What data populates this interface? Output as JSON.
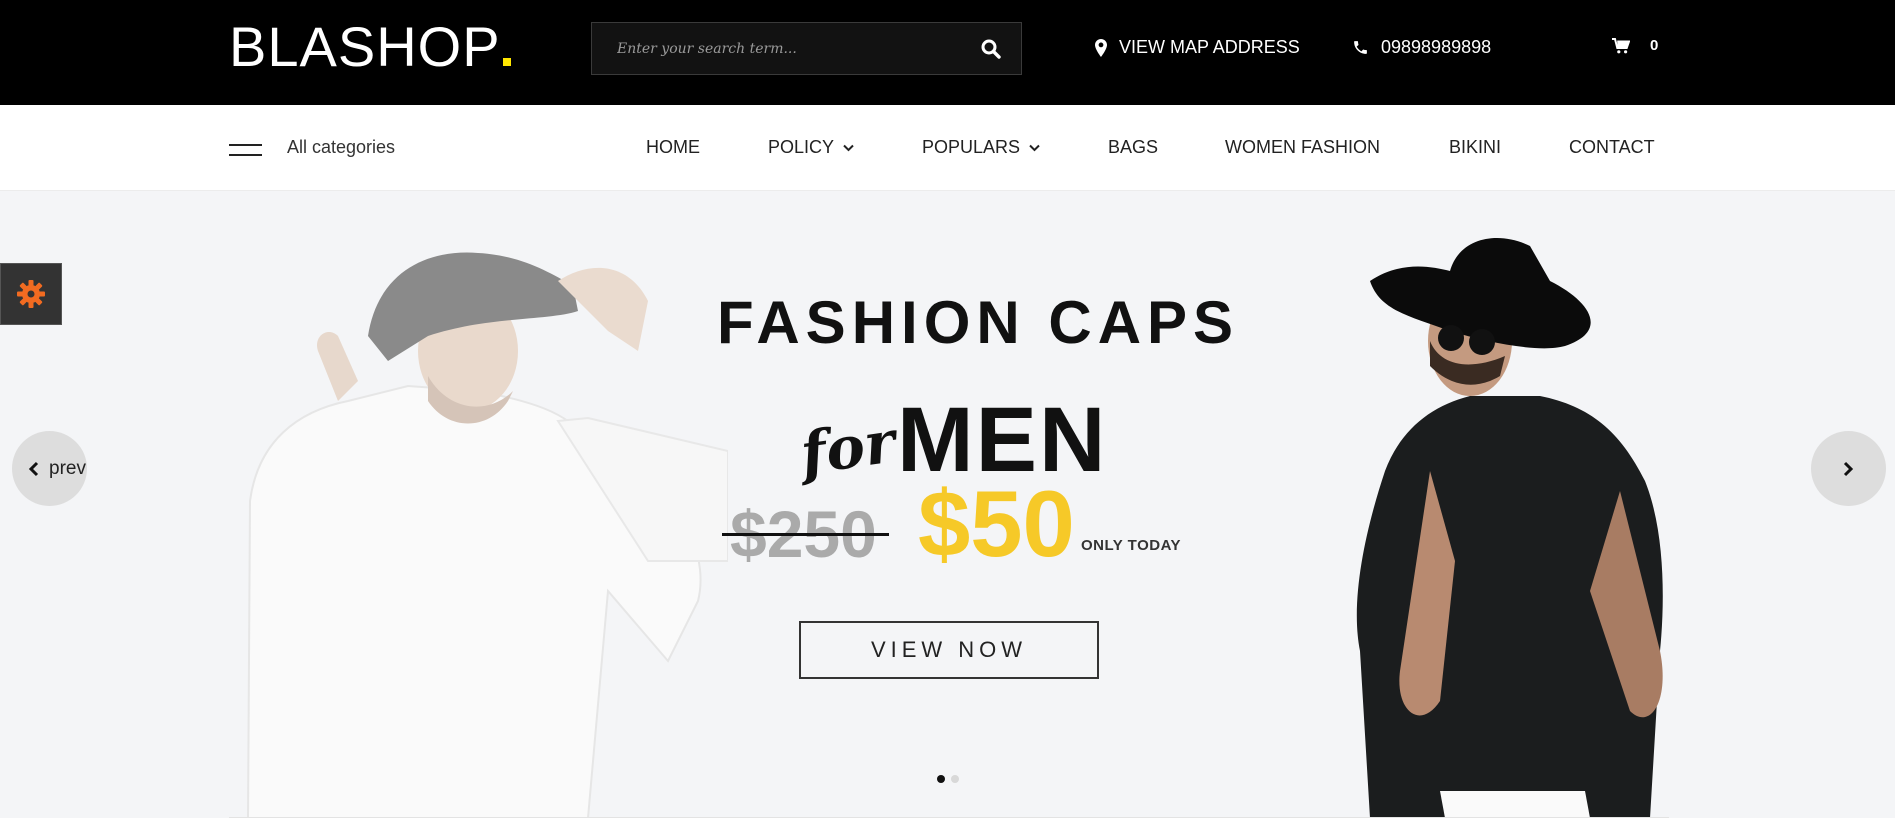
{
  "header": {
    "logo_text": "BLASHOP",
    "logo_dot_color": "#ffe600",
    "search_placeholder": "Enter your search term...",
    "map_label": "VIEW MAP ADDRESS",
    "phone": "09898989898",
    "cart_count": "0"
  },
  "nav": {
    "all_categories": "All categories",
    "items": [
      {
        "label": "HOME",
        "has_dropdown": false
      },
      {
        "label": "POLICY",
        "has_dropdown": true
      },
      {
        "label": "POPULARS",
        "has_dropdown": true
      },
      {
        "label": "BAGS",
        "has_dropdown": false
      },
      {
        "label": "WOMEN FASHION",
        "has_dropdown": false
      },
      {
        "label": "BIKINI",
        "has_dropdown": false
      },
      {
        "label": "CONTACT",
        "has_dropdown": false
      }
    ]
  },
  "hero": {
    "title": "FASHION CAPS",
    "for_text": "for",
    "men_text": "MEN",
    "old_price": "$250",
    "new_price": "$50",
    "price_note": "ONLY TODAY",
    "cta_label": "VIEW NOW",
    "prev_label": "prev",
    "slide_count": 2,
    "active_slide": 1
  },
  "colors": {
    "accent_yellow": "#f6c928",
    "settings_gear": "#f26b21",
    "topbar_bg": "#000000",
    "hero_bg": "#f4f5f7"
  },
  "icons": {
    "search": "search-icon",
    "map": "map-marker-icon",
    "phone": "phone-icon",
    "cart": "shopping-cart-icon",
    "menu": "hamburger-menu-icon",
    "dropdown": "chevron-down-icon",
    "settings": "gear-icon",
    "prev": "chevron-left-icon",
    "next": "chevron-right-icon"
  }
}
